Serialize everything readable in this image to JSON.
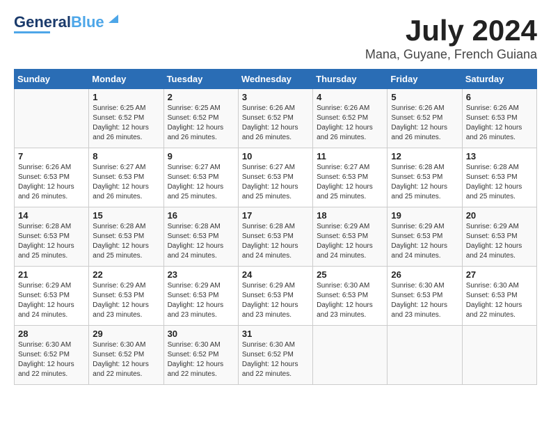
{
  "header": {
    "logo_line1": "General",
    "logo_line2": "Blue",
    "month": "July 2024",
    "location": "Mana, Guyane, French Guiana"
  },
  "days_of_week": [
    "Sunday",
    "Monday",
    "Tuesday",
    "Wednesday",
    "Thursday",
    "Friday",
    "Saturday"
  ],
  "weeks": [
    [
      {
        "day": "",
        "info": ""
      },
      {
        "day": "1",
        "info": "Sunrise: 6:25 AM\nSunset: 6:52 PM\nDaylight: 12 hours\nand 26 minutes."
      },
      {
        "day": "2",
        "info": "Sunrise: 6:25 AM\nSunset: 6:52 PM\nDaylight: 12 hours\nand 26 minutes."
      },
      {
        "day": "3",
        "info": "Sunrise: 6:26 AM\nSunset: 6:52 PM\nDaylight: 12 hours\nand 26 minutes."
      },
      {
        "day": "4",
        "info": "Sunrise: 6:26 AM\nSunset: 6:52 PM\nDaylight: 12 hours\nand 26 minutes."
      },
      {
        "day": "5",
        "info": "Sunrise: 6:26 AM\nSunset: 6:52 PM\nDaylight: 12 hours\nand 26 minutes."
      },
      {
        "day": "6",
        "info": "Sunrise: 6:26 AM\nSunset: 6:53 PM\nDaylight: 12 hours\nand 26 minutes."
      }
    ],
    [
      {
        "day": "7",
        "info": "Sunrise: 6:26 AM\nSunset: 6:53 PM\nDaylight: 12 hours\nand 26 minutes."
      },
      {
        "day": "8",
        "info": "Sunrise: 6:27 AM\nSunset: 6:53 PM\nDaylight: 12 hours\nand 26 minutes."
      },
      {
        "day": "9",
        "info": "Sunrise: 6:27 AM\nSunset: 6:53 PM\nDaylight: 12 hours\nand 25 minutes."
      },
      {
        "day": "10",
        "info": "Sunrise: 6:27 AM\nSunset: 6:53 PM\nDaylight: 12 hours\nand 25 minutes."
      },
      {
        "day": "11",
        "info": "Sunrise: 6:27 AM\nSunset: 6:53 PM\nDaylight: 12 hours\nand 25 minutes."
      },
      {
        "day": "12",
        "info": "Sunrise: 6:28 AM\nSunset: 6:53 PM\nDaylight: 12 hours\nand 25 minutes."
      },
      {
        "day": "13",
        "info": "Sunrise: 6:28 AM\nSunset: 6:53 PM\nDaylight: 12 hours\nand 25 minutes."
      }
    ],
    [
      {
        "day": "14",
        "info": "Sunrise: 6:28 AM\nSunset: 6:53 PM\nDaylight: 12 hours\nand 25 minutes."
      },
      {
        "day": "15",
        "info": "Sunrise: 6:28 AM\nSunset: 6:53 PM\nDaylight: 12 hours\nand 25 minutes."
      },
      {
        "day": "16",
        "info": "Sunrise: 6:28 AM\nSunset: 6:53 PM\nDaylight: 12 hours\nand 24 minutes."
      },
      {
        "day": "17",
        "info": "Sunrise: 6:28 AM\nSunset: 6:53 PM\nDaylight: 12 hours\nand 24 minutes."
      },
      {
        "day": "18",
        "info": "Sunrise: 6:29 AM\nSunset: 6:53 PM\nDaylight: 12 hours\nand 24 minutes."
      },
      {
        "day": "19",
        "info": "Sunrise: 6:29 AM\nSunset: 6:53 PM\nDaylight: 12 hours\nand 24 minutes."
      },
      {
        "day": "20",
        "info": "Sunrise: 6:29 AM\nSunset: 6:53 PM\nDaylight: 12 hours\nand 24 minutes."
      }
    ],
    [
      {
        "day": "21",
        "info": "Sunrise: 6:29 AM\nSunset: 6:53 PM\nDaylight: 12 hours\nand 24 minutes."
      },
      {
        "day": "22",
        "info": "Sunrise: 6:29 AM\nSunset: 6:53 PM\nDaylight: 12 hours\nand 23 minutes."
      },
      {
        "day": "23",
        "info": "Sunrise: 6:29 AM\nSunset: 6:53 PM\nDaylight: 12 hours\nand 23 minutes."
      },
      {
        "day": "24",
        "info": "Sunrise: 6:29 AM\nSunset: 6:53 PM\nDaylight: 12 hours\nand 23 minutes."
      },
      {
        "day": "25",
        "info": "Sunrise: 6:30 AM\nSunset: 6:53 PM\nDaylight: 12 hours\nand 23 minutes."
      },
      {
        "day": "26",
        "info": "Sunrise: 6:30 AM\nSunset: 6:53 PM\nDaylight: 12 hours\nand 23 minutes."
      },
      {
        "day": "27",
        "info": "Sunrise: 6:30 AM\nSunset: 6:53 PM\nDaylight: 12 hours\nand 22 minutes."
      }
    ],
    [
      {
        "day": "28",
        "info": "Sunrise: 6:30 AM\nSunset: 6:52 PM\nDaylight: 12 hours\nand 22 minutes."
      },
      {
        "day": "29",
        "info": "Sunrise: 6:30 AM\nSunset: 6:52 PM\nDaylight: 12 hours\nand 22 minutes."
      },
      {
        "day": "30",
        "info": "Sunrise: 6:30 AM\nSunset: 6:52 PM\nDaylight: 12 hours\nand 22 minutes."
      },
      {
        "day": "31",
        "info": "Sunrise: 6:30 AM\nSunset: 6:52 PM\nDaylight: 12 hours\nand 22 minutes."
      },
      {
        "day": "",
        "info": ""
      },
      {
        "day": "",
        "info": ""
      },
      {
        "day": "",
        "info": ""
      }
    ]
  ]
}
